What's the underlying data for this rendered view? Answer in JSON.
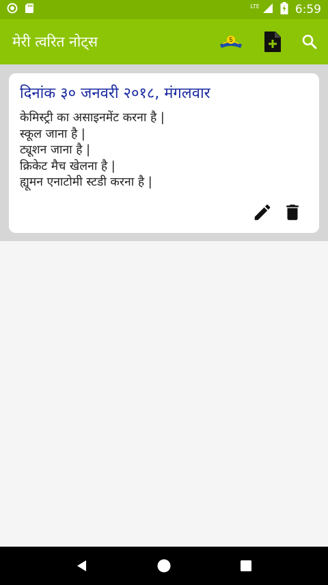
{
  "status_bar": {
    "time": "6:59",
    "network_label": "LTE",
    "icons": [
      "notification-circle-icon",
      "sd-card-icon",
      "signal-icon",
      "battery-icon"
    ]
  },
  "app_bar": {
    "title": "मेरी त्वरित नोट्स",
    "badge_number": "5",
    "actions": [
      "promo-badge-icon",
      "add-note-icon",
      "search-icon"
    ]
  },
  "notes": [
    {
      "date": "दिनांक ३० जनवरी २०१८, मंगलवार",
      "lines": [
        "केमिस्ट्री का असाइनमेंट करना है |",
        "स्कूल जाना है |",
        "ट्यूशन जाना है |",
        "क्रिकेट मैच खेलना है |",
        "ह्यूमन एनाटोमी स्टडी करना है |"
      ],
      "actions": [
        "edit-icon",
        "delete-icon"
      ]
    }
  ],
  "nav_bar": {
    "buttons": [
      "back-icon",
      "home-icon",
      "recents-icon"
    ]
  },
  "colors": {
    "status_bar": "#7cb300",
    "app_bar": "#8cc406",
    "note_date": "#1a2aa0",
    "content_top": "#d6d6d6",
    "background": "#f5f5f5"
  }
}
